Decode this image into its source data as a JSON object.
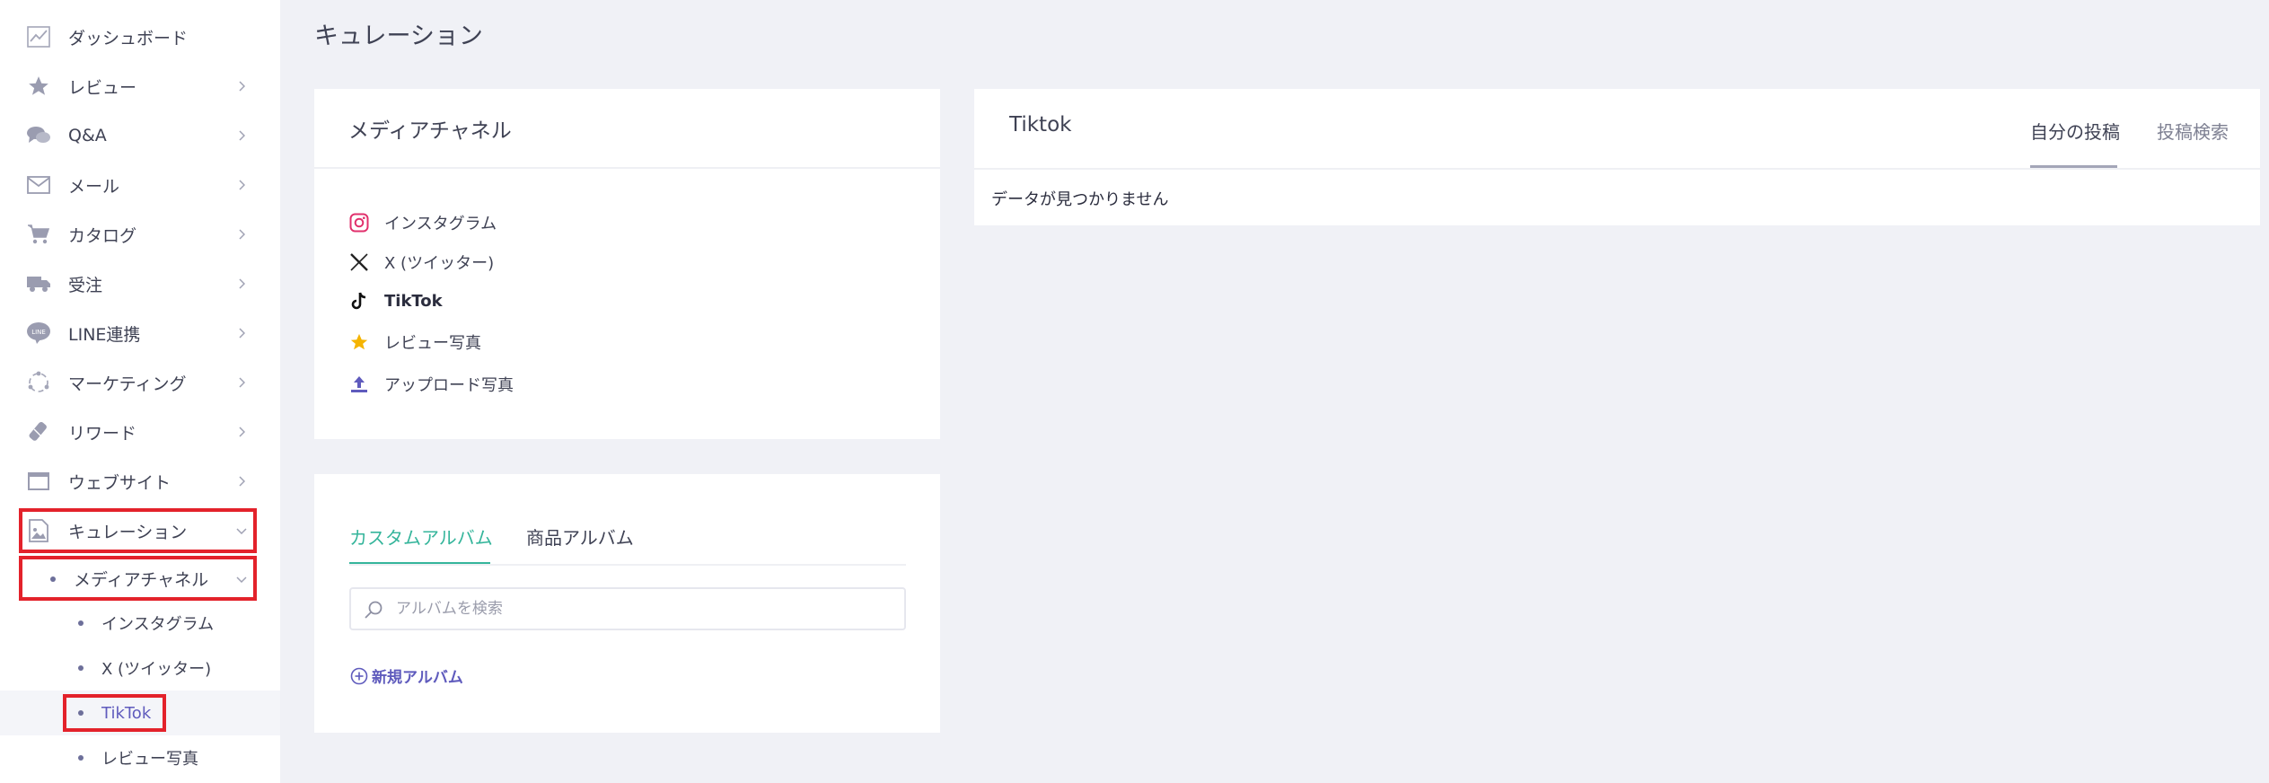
{
  "sidebar": {
    "items": [
      {
        "label": "ダッシュボード",
        "icon": "dashboard-chart-icon"
      },
      {
        "label": "レビュー",
        "icon": "star-icon"
      },
      {
        "label": "Q&A",
        "icon": "chat-bubbles-icon"
      },
      {
        "label": "メール",
        "icon": "envelope-icon"
      },
      {
        "label": "カタログ",
        "icon": "cart-icon"
      },
      {
        "label": "受注",
        "icon": "truck-icon"
      },
      {
        "label": "LINE連携",
        "icon": "line-icon"
      },
      {
        "label": "マーケティング",
        "icon": "marketing-icon"
      },
      {
        "label": "リワード",
        "icon": "reward-icon"
      },
      {
        "label": "ウェブサイト",
        "icon": "browser-window-icon"
      },
      {
        "label": "キュレーション",
        "icon": "image-file-icon"
      }
    ],
    "submenu": {
      "label": "メディアチャネル"
    },
    "subitems": [
      {
        "label": "インスタグラム"
      },
      {
        "label": "X (ツイッター)"
      },
      {
        "label": "TikTok"
      },
      {
        "label": "レビュー写真"
      }
    ]
  },
  "main": {
    "title": "キュレーション",
    "media_card": {
      "title": "メディアチャネル",
      "channels": [
        {
          "label": "インスタグラム",
          "icon": "instagram-icon"
        },
        {
          "label": "X (ツイッター)",
          "icon": "x-logo-icon"
        },
        {
          "label": "TikTok",
          "icon": "tiktok-icon"
        },
        {
          "label": "レビュー写真",
          "icon": "star-icon"
        },
        {
          "label": "アップロード写真",
          "icon": "upload-icon"
        }
      ]
    },
    "album_card": {
      "tabs": [
        {
          "label": "カスタムアルバム"
        },
        {
          "label": "商品アルバム"
        }
      ],
      "search_placeholder": "アルバムを検索",
      "new_album": "新規アルバム"
    },
    "tiktok_card": {
      "title": "Tiktok",
      "tabs": [
        {
          "label": "自分の投稿"
        },
        {
          "label": "投稿検索"
        }
      ],
      "empty_text": "データが見つかりません"
    }
  },
  "colors": {
    "accent_teal": "#35b59b",
    "accent_purple": "#5f5bbd",
    "highlight_red": "#e3222b",
    "instagram": "#e1306c",
    "star": "#f5b400"
  }
}
